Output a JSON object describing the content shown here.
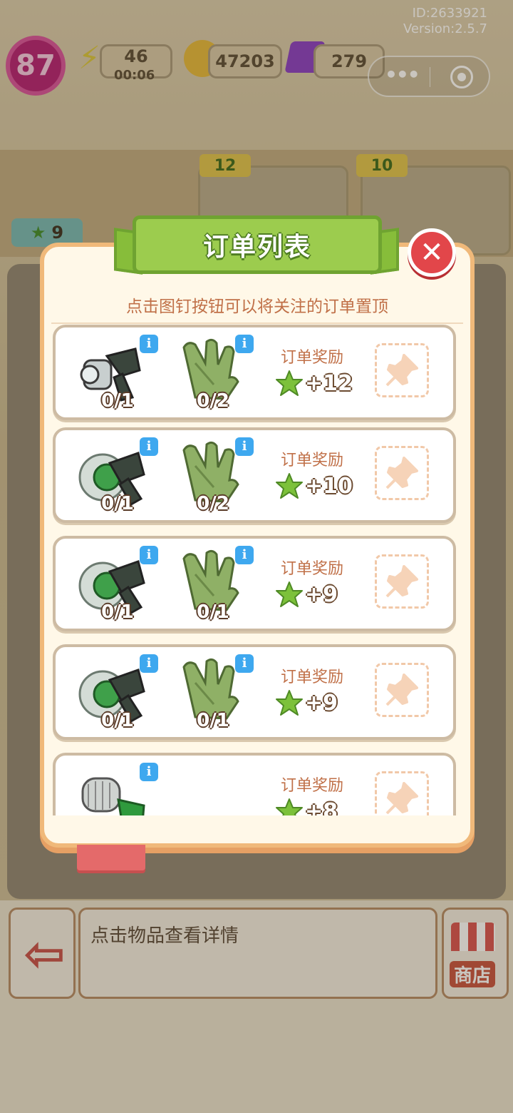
{
  "meta": {
    "id_text": "ID:2633921",
    "version_text": "Version:2.5.7"
  },
  "hud": {
    "level": "87",
    "energy": "46",
    "energy_timer": "00:06",
    "coins": "47203",
    "gems": "279",
    "helper_count": "9",
    "shelf_badges": [
      "12",
      "10"
    ],
    "capsule": {
      "more_icon": "more-dots-icon",
      "close_icon": "target-icon"
    }
  },
  "bottom": {
    "hint": "点击物品查看详情",
    "shop_label": "商店"
  },
  "modal": {
    "title": "订单列表",
    "subtitle": "点击图钉按钮可以将关注的订单置顶",
    "reward_label": "订单奖励",
    "orders": [
      {
        "items": [
          {
            "icon": "drill-icon",
            "progress": "0/1"
          },
          {
            "icon": "glove-icon",
            "progress": "0/2"
          }
        ],
        "reward": "+12"
      },
      {
        "items": [
          {
            "icon": "grinder-icon",
            "progress": "0/1"
          },
          {
            "icon": "glove-icon",
            "progress": "0/2"
          }
        ],
        "reward": "+10"
      },
      {
        "items": [
          {
            "icon": "grinder-icon",
            "progress": "0/1"
          },
          {
            "icon": "glove-icon",
            "progress": "0/1"
          }
        ],
        "reward": "+9"
      },
      {
        "items": [
          {
            "icon": "grinder-icon",
            "progress": "0/1"
          },
          {
            "icon": "glove-icon",
            "progress": "0/1"
          }
        ],
        "reward": "+9"
      },
      {
        "items": [
          {
            "icon": "roller-icon",
            "progress": ""
          }
        ],
        "reward": "+8"
      }
    ]
  },
  "colors": {
    "accent_green": "#9ccc4e",
    "close_red": "#e2464a",
    "info_blue": "#3ea8ef",
    "label_orange": "#c07048"
  }
}
